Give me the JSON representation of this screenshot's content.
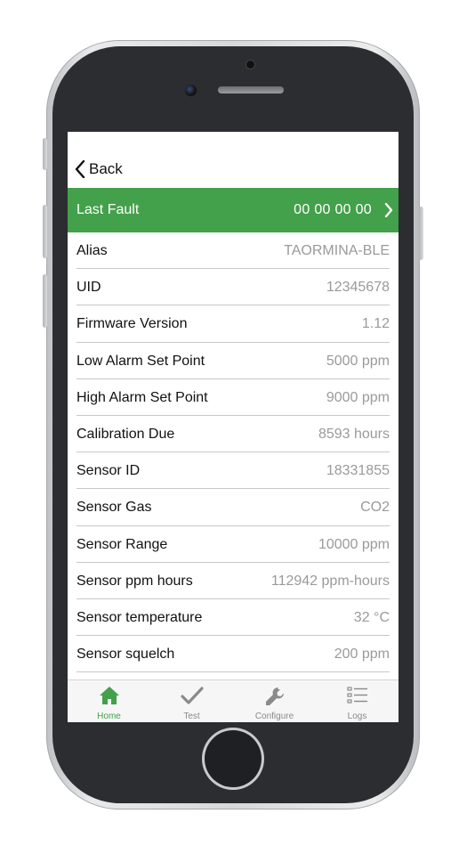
{
  "nav": {
    "back_label": "Back"
  },
  "last_fault": {
    "label": "Last Fault",
    "value": "00 00 00 00"
  },
  "rows": [
    {
      "label": "Alias",
      "value": "TAORMINA-BLE"
    },
    {
      "label": "UID",
      "value": "12345678"
    },
    {
      "label": "Firmware Version",
      "value": "1.12"
    },
    {
      "label": "Low Alarm Set Point",
      "value": "5000 ppm"
    },
    {
      "label": "High Alarm Set Point",
      "value": "9000 ppm"
    },
    {
      "label": "Calibration Due",
      "value": "8593 hours"
    },
    {
      "label": "Sensor ID",
      "value": "18331855"
    },
    {
      "label": "Sensor Gas",
      "value": "CO2"
    },
    {
      "label": "Sensor Range",
      "value": "10000 ppm"
    },
    {
      "label": "Sensor ppm hours",
      "value": "112942 ppm-hours"
    },
    {
      "label": "Sensor temperature",
      "value": "32 °C"
    },
    {
      "label": "Sensor squelch",
      "value": "200 ppm"
    }
  ],
  "tabs": [
    {
      "label": "Home",
      "icon": "home-icon",
      "active": true
    },
    {
      "label": "Test",
      "icon": "checkmark-icon",
      "active": false
    },
    {
      "label": "Configure",
      "icon": "wrench-icon",
      "active": false
    },
    {
      "label": "Logs",
      "icon": "list-icon",
      "active": false
    }
  ],
  "colors": {
    "accent_green": "#43a04b",
    "value_gray": "#9a9a9a",
    "tab_inactive": "#8a8a8a",
    "phone_bezel": "#2b2d30"
  }
}
